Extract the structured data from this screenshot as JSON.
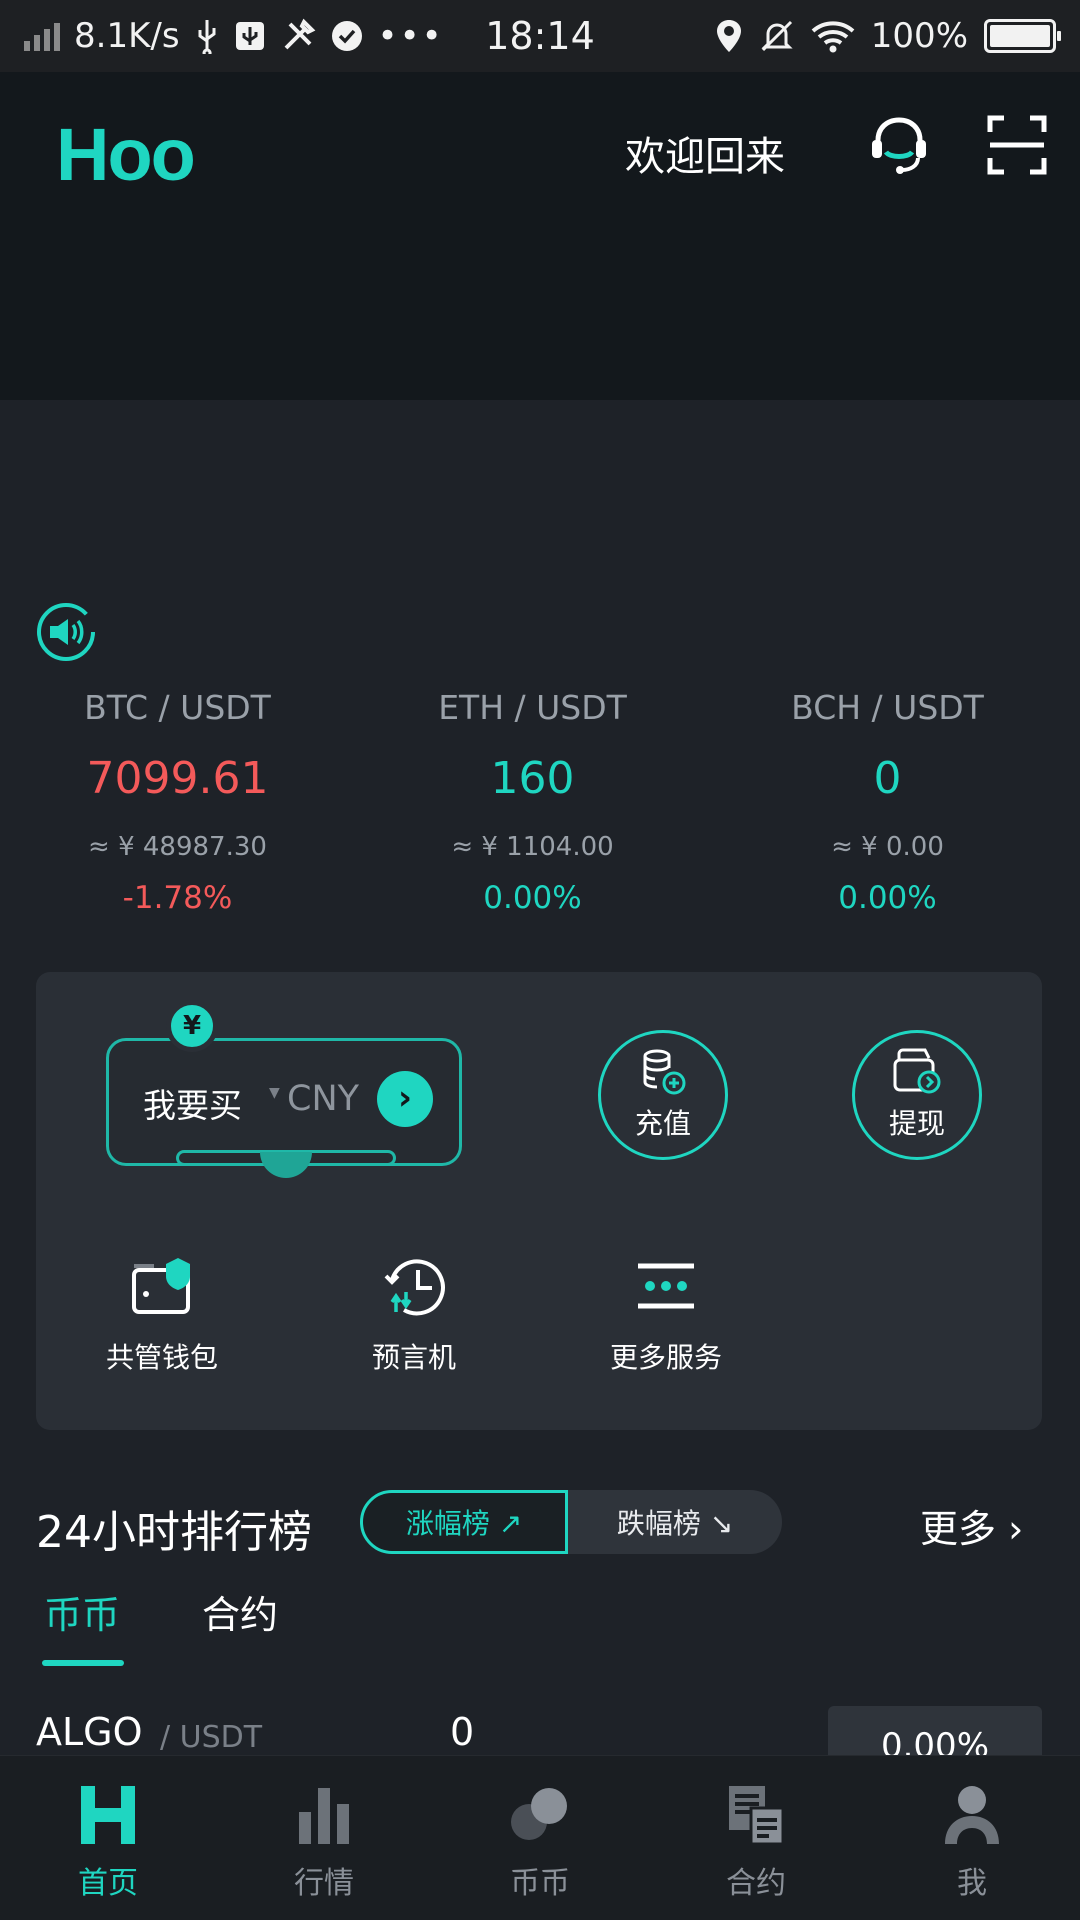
{
  "status_bar": {
    "net_speed": "8.1K/s",
    "time": "18:14",
    "battery": "100%"
  },
  "header": {
    "logo": "Hoo",
    "welcome": "欢迎回来"
  },
  "tickers": [
    {
      "pair": "BTC / USDT",
      "price": "7099.61",
      "approx": "≈ ¥ 48987.30",
      "change": "-1.78%",
      "trend": "down"
    },
    {
      "pair": "ETH / USDT",
      "price": "160",
      "approx": "≈ ¥ 1104.00",
      "change": "0.00%",
      "trend": "flat"
    },
    {
      "pair": "BCH / USDT",
      "price": "0",
      "approx": "≈ ¥ 0.00",
      "change": "0.00%",
      "trend": "flat"
    }
  ],
  "services": {
    "buy_label": "我要买",
    "buy_currency": "CNY",
    "coin_symbol": "¥",
    "deposit": "充值",
    "withdraw": "提现",
    "items": [
      {
        "label": "共管钱包",
        "icon": "wallet-shield-icon"
      },
      {
        "label": "预言机",
        "icon": "oracle-clock-icon"
      },
      {
        "label": "更多服务",
        "icon": "more-services-icon"
      }
    ]
  },
  "rankings": {
    "title": "24小时排行榜",
    "gainers": "涨幅榜 ↗",
    "losers": "跌幅榜 ↘",
    "more": "更多 ›",
    "tabs": [
      "币币",
      "合约"
    ],
    "rows": [
      {
        "base": "ALGO",
        "quote": "/ USDT",
        "price": "0",
        "change": "0.00%"
      }
    ]
  },
  "bottom_nav": [
    {
      "label": "首页",
      "icon": "home-h-icon",
      "active": true
    },
    {
      "label": "行情",
      "icon": "market-bars-icon",
      "active": false
    },
    {
      "label": "币币",
      "icon": "coins-icon",
      "active": false
    },
    {
      "label": "合约",
      "icon": "contract-doc-icon",
      "active": false
    },
    {
      "label": "我",
      "icon": "profile-icon",
      "active": false
    }
  ],
  "colors": {
    "accent": "#1fd6c1",
    "down": "#f45a5a",
    "background": "#1e2228",
    "header_bg": "#13181c",
    "card_bg": "#2a2f36"
  }
}
